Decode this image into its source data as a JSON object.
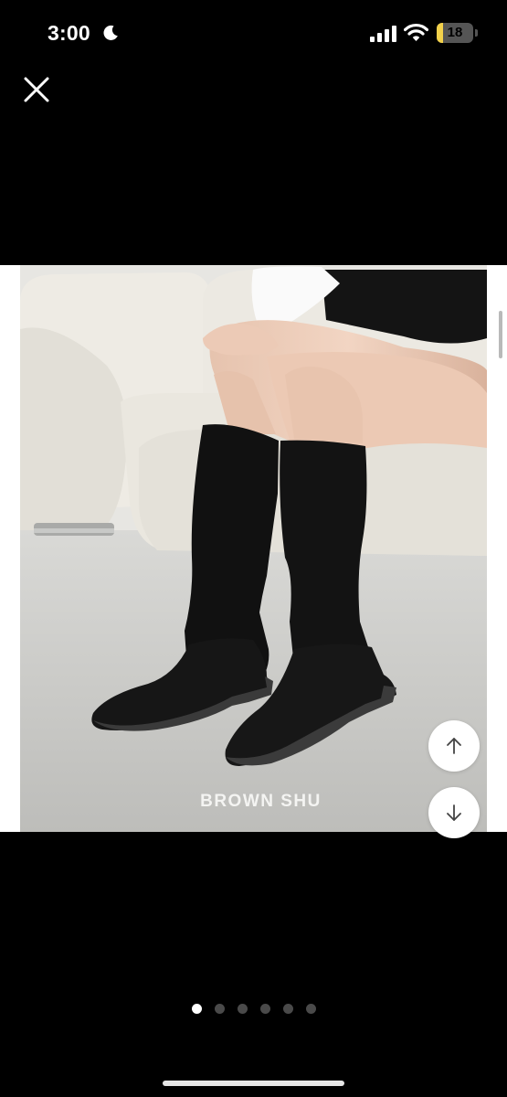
{
  "status_bar": {
    "time": "3:00",
    "battery_level": "18",
    "battery_fraction": 0.18,
    "icons": [
      "moon-icon",
      "signal-icon",
      "wifi-icon",
      "battery-icon"
    ]
  },
  "viewer": {
    "close_icon": "close-icon",
    "photo_caption": "BROWN SHU",
    "scroll_up_icon": "arrow-up-icon",
    "scroll_down_icon": "arrow-down-icon"
  },
  "pager": {
    "total": 6,
    "current": 1
  },
  "colors": {
    "background": "#000000",
    "battery_fill": "#f2d14b",
    "active_dot": "#ffffff",
    "inactive_dot": "#4a4a4a"
  }
}
